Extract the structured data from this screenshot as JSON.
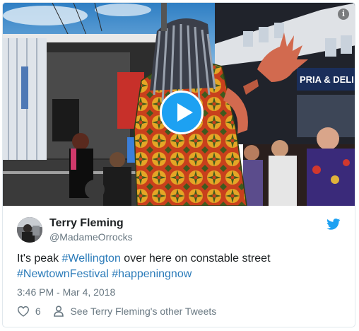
{
  "tweet": {
    "author_name": "Terry Fleming",
    "author_handle": "@MadameOrrocks",
    "text_lead": "It's peak ",
    "hashtag_1": "#Wellington",
    "text_mid": " over here on constable street",
    "hashtag_2": "#NewtownFestival",
    "hashtag_3": "#happeningnow",
    "timestamp": "3:46 PM - Mar 4, 2018",
    "like_count": "6",
    "see_more_label": "See Terry Fleming's other Tweets"
  },
  "media": {
    "storefront_sign": "PRIA & DELI",
    "info_icon": "i"
  },
  "icons": {
    "play": "play-icon",
    "info": "info-icon",
    "twitter": "twitter-bird-icon",
    "like": "heart-icon",
    "profile": "person-icon"
  },
  "colors": {
    "brand_blue": "#1da1f2",
    "link_blue": "#2b7bb9",
    "text": "#1c2022",
    "muted": "#697882"
  }
}
